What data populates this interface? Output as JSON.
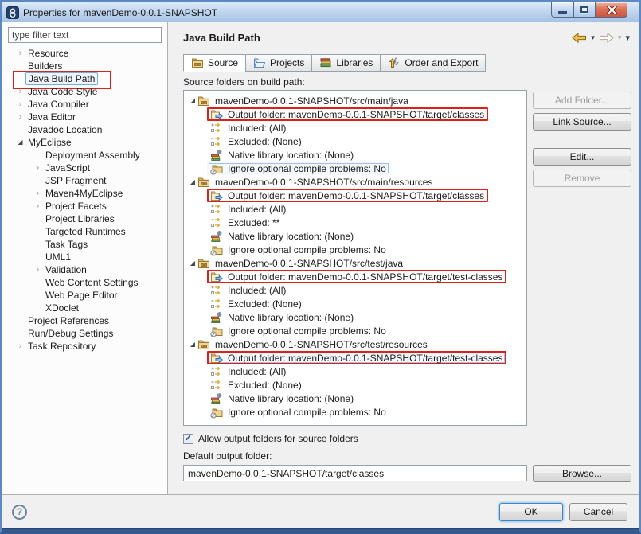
{
  "colors": {
    "annotation_red": "#df1f1c",
    "selection_border": "#a0c4e6",
    "selection_fill": "#f2f8fd",
    "titlebar_top": "#dce9f7",
    "titlebar_bottom": "#a4c2e4",
    "window_border": "#5c88c3",
    "close_red": "#cf5542",
    "default_button_glow": "#8fc0ea"
  },
  "icons": {
    "collapsed_glyph": "›",
    "expanded_glyph": "◢",
    "caret_glyph": "▾",
    "check_glyph": "✓"
  },
  "window": {
    "title": "Properties for mavenDemo-0.0.1-SNAPSHOT"
  },
  "sidebar": {
    "filter_placeholder": "type filter text",
    "items": [
      {
        "label": "Resource",
        "level": 0,
        "arrow": "collapsed"
      },
      {
        "label": "Builders",
        "level": 0,
        "arrow": "none"
      },
      {
        "label": "Java Build Path",
        "level": 0,
        "arrow": "none",
        "selected": true,
        "annotated": true
      },
      {
        "label": "Java Code Style",
        "level": 0,
        "arrow": "collapsed"
      },
      {
        "label": "Java Compiler",
        "level": 0,
        "arrow": "collapsed"
      },
      {
        "label": "Java Editor",
        "level": 0,
        "arrow": "collapsed"
      },
      {
        "label": "Javadoc Location",
        "level": 0,
        "arrow": "none"
      },
      {
        "label": "MyEclipse",
        "level": 0,
        "arrow": "expanded"
      },
      {
        "label": "Deployment Assembly",
        "level": 1,
        "arrow": "none"
      },
      {
        "label": "JavaScript",
        "level": 1,
        "arrow": "collapsed"
      },
      {
        "label": "JSP Fragment",
        "level": 1,
        "arrow": "none"
      },
      {
        "label": "Maven4MyEclipse",
        "level": 1,
        "arrow": "collapsed"
      },
      {
        "label": "Project Facets",
        "level": 1,
        "arrow": "collapsed"
      },
      {
        "label": "Project Libraries",
        "level": 1,
        "arrow": "none"
      },
      {
        "label": "Targeted Runtimes",
        "level": 1,
        "arrow": "none"
      },
      {
        "label": "Task Tags",
        "level": 1,
        "arrow": "none"
      },
      {
        "label": "UML1",
        "level": 1,
        "arrow": "none"
      },
      {
        "label": "Validation",
        "level": 1,
        "arrow": "collapsed"
      },
      {
        "label": "Web Content Settings",
        "level": 1,
        "arrow": "none"
      },
      {
        "label": "Web Page Editor",
        "level": 1,
        "arrow": "none"
      },
      {
        "label": "XDoclet",
        "level": 1,
        "arrow": "none"
      },
      {
        "label": "Project References",
        "level": 0,
        "arrow": "none"
      },
      {
        "label": "Run/Debug Settings",
        "level": 0,
        "arrow": "none"
      },
      {
        "label": "Task Repository",
        "level": 0,
        "arrow": "collapsed"
      }
    ]
  },
  "header": {
    "title": "Java Build Path"
  },
  "tabs": [
    {
      "label": "Source",
      "icon": "source",
      "active": true
    },
    {
      "label": "Projects",
      "icon": "projects",
      "active": false
    },
    {
      "label": "Libraries",
      "icon": "libraries",
      "active": false
    },
    {
      "label": "Order and Export",
      "icon": "order",
      "active": false
    }
  ],
  "source_tab": {
    "caption": "Source folders on build path:",
    "groups": [
      {
        "path": "mavenDemo-0.0.1-SNAPSHOT/src/main/java",
        "children": [
          {
            "type": "output",
            "text": "Output folder: mavenDemo-0.0.1-SNAPSHOT/target/classes",
            "annotated": true
          },
          {
            "type": "included",
            "text": "Included: (All)"
          },
          {
            "type": "excluded",
            "text": "Excluded: (None)"
          },
          {
            "type": "native",
            "text": "Native library location: (None)"
          },
          {
            "type": "ignore",
            "text": "Ignore optional compile problems: No",
            "selected": true
          }
        ]
      },
      {
        "path": "mavenDemo-0.0.1-SNAPSHOT/src/main/resources",
        "children": [
          {
            "type": "output",
            "text": "Output folder: mavenDemo-0.0.1-SNAPSHOT/target/classes",
            "annotated": true
          },
          {
            "type": "included",
            "text": "Included: (All)"
          },
          {
            "type": "excluded",
            "text": "Excluded: **"
          },
          {
            "type": "native",
            "text": "Native library location: (None)"
          },
          {
            "type": "ignore",
            "text": "Ignore optional compile problems: No"
          }
        ]
      },
      {
        "path": "mavenDemo-0.0.1-SNAPSHOT/src/test/java",
        "children": [
          {
            "type": "output",
            "text": "Output folder: mavenDemo-0.0.1-SNAPSHOT/target/test-classes",
            "annotated": true
          },
          {
            "type": "included",
            "text": "Included: (All)"
          },
          {
            "type": "excluded",
            "text": "Excluded: (None)"
          },
          {
            "type": "native",
            "text": "Native library location: (None)"
          },
          {
            "type": "ignore",
            "text": "Ignore optional compile problems: No"
          }
        ]
      },
      {
        "path": "mavenDemo-0.0.1-SNAPSHOT/src/test/resources",
        "children": [
          {
            "type": "output",
            "text": "Output folder: mavenDemo-0.0.1-SNAPSHOT/target/test-classes",
            "annotated": true,
            "selected": true
          },
          {
            "type": "included",
            "text": "Included: (All)"
          },
          {
            "type": "excluded",
            "text": "Excluded: (None)"
          },
          {
            "type": "native",
            "text": "Native library location: (None)"
          },
          {
            "type": "ignore",
            "text": "Ignore optional compile problems: No"
          }
        ]
      }
    ],
    "buttons": [
      {
        "label": "Add Folder...",
        "enabled": false
      },
      {
        "label": "Link Source...",
        "enabled": true
      },
      {
        "label": "Edit...",
        "enabled": true,
        "gap_before": true
      },
      {
        "label": "Remove",
        "enabled": false
      }
    ],
    "allow_output_label": "Allow output folders for source folders",
    "allow_output_checked": true,
    "default_output_label": "Default output folder:",
    "default_output_value": "mavenDemo-0.0.1-SNAPSHOT/target/classes",
    "browse_label": "Browse..."
  },
  "footer": {
    "help_glyph": "?",
    "ok": "OK",
    "cancel": "Cancel"
  }
}
